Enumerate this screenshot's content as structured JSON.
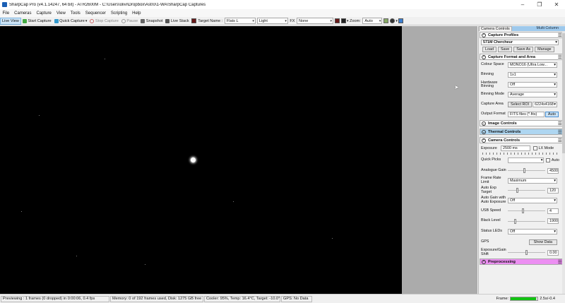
{
  "window": {
    "title": "SharpCap Pro (v4.1.14247, 64 bit) - ATR2600M - C:\\Users\\olivi\\Dropbox\\Astro\\1-WA\\SharpCap Captures",
    "controls": {
      "minimize": "–",
      "maximize": "❐",
      "close": "✕"
    }
  },
  "menu": [
    "File",
    "Cameras",
    "Capture",
    "View",
    "Tools",
    "Sequencer",
    "Scripting",
    "Help"
  ],
  "toolbar": {
    "live_view": "Live View",
    "start_capture": "Start Capture",
    "quick_capture": "Quick Capture",
    "stop_capture": "Stop Capture",
    "pause": "Pause",
    "snapshot": "Snapshot",
    "live_stack": "Live Stack",
    "target_name_label": "Target Name :",
    "target_name_value": "Flats L",
    "light_value": "Light",
    "fx_label": "FX",
    "fx_value": "None",
    "zoom_label": "Zoom:",
    "zoom_value": "Auto"
  },
  "panel": {
    "tabs": {
      "camera_controls": "Camera Controls",
      "multi_column": "Multi Column"
    },
    "capture_profiles": {
      "title": "Capture Profiles",
      "profile": "571M Chercheur",
      "load": "Load",
      "save": "Save",
      "save_as": "Save As",
      "manage": "Manage"
    },
    "capture_format": {
      "title": "Capture Format and Area",
      "colour_space_label": "Colour Space",
      "colour_space_value": "MONO16 (Ultra Low...",
      "binning_label": "Binning",
      "binning_value": "1x1",
      "hw_binning_label": "Hardware Binning",
      "hw_binning_value": "Off",
      "binning_mode_label": "Binning Mode",
      "binning_mode_value": "Average",
      "capture_area_label": "Capture Area",
      "select_roi": "Select ROI",
      "capture_area_value": "6224x4168",
      "output_format_label": "Output Format",
      "output_format_value": "FITS files (*.fits)",
      "auto": "Auto"
    },
    "image_controls": {
      "title": "Image Controls"
    },
    "thermal_controls": {
      "title": "Thermal Controls"
    },
    "camera_controls": {
      "title": "Camera Controls",
      "exposure_label": "Exposure",
      "exposure_value": "2500 ms",
      "lx_mode": "LX Mode",
      "quick_picks_label": "Quick Picks",
      "auto_label": "Auto",
      "gain_label": "Analogue Gain",
      "gain_value": "4500",
      "gain_level": 0.45,
      "frame_rate_label": "Frame Rate Limit",
      "frame_rate_value": "Maximum",
      "auto_exp_target_label": "Auto Exp Target",
      "auto_exp_target_value": "120",
      "auto_exp_level": 0.25,
      "auto_gain_label": "Auto Gain with Auto Exposure",
      "auto_gain_value": "Off",
      "usb_speed_label": "USB Speed",
      "usb_speed_value": "4",
      "usb_level": 0.4,
      "black_level_label": "Black Level",
      "black_level_value": "1900",
      "black_level": 0.2,
      "status_leds_label": "Status LEDs",
      "status_leds_value": "Off",
      "gps_label": "GPS",
      "show_data": "Show Data",
      "exp_gain_shift_label": "Exposure/Gain Shift",
      "exp_gain_shift_value": "0.00",
      "shift_level": 0.5
    },
    "preprocessing": {
      "title": "Preprocessing"
    }
  },
  "status": {
    "previewing": "Previewing : 1 frames (0 dropped) in 0:00:06, 0.4 fps",
    "memory": "Memory: 0 of 192 frames used, Disk: 1275 GB free",
    "cooler": "Cooler: 95%, Temp: 16.4°C, Target: -10.0°C",
    "gps": "GPS: No Data",
    "frame_label": "Frame:",
    "frame_value": "2.5s/-0.4",
    "frame_progress": 0.95
  },
  "colors": {
    "accent_blue": "#aed6f1",
    "preprocessing_pink": "#ec8ff2",
    "progress_green": "#13c313"
  }
}
